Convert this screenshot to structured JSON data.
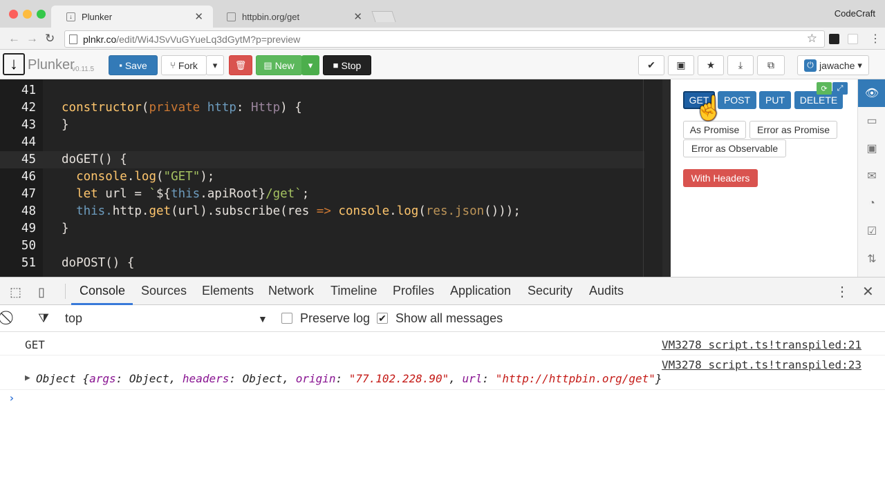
{
  "browser": {
    "tabs": [
      {
        "title": "Plunker",
        "active": true
      },
      {
        "title": "httpbin.org/get",
        "active": false
      }
    ],
    "profile": "CodeCraft",
    "url_host": "plnkr.co",
    "url_path": "/edit/Wi4JSvVuGYueLq3dGytM?p=preview"
  },
  "plunker": {
    "logo_text": "Plunker",
    "version": "v0.11.5",
    "buttons": {
      "save": "Save",
      "fork": "Fork",
      "new": "New",
      "stop": "Stop"
    },
    "user": "jawache"
  },
  "editor": {
    "lines": [
      {
        "n": "41",
        "tokens": []
      },
      {
        "n": "42",
        "tokens": [
          {
            "c": "fn",
            "t": "constructor"
          },
          {
            "c": "",
            "t": "("
          },
          {
            "c": "kw",
            "t": "private"
          },
          {
            "c": "",
            "t": " "
          },
          {
            "c": "ths",
            "t": "http"
          },
          {
            "c": "",
            "t": ": "
          },
          {
            "c": "tp",
            "t": "Http"
          },
          {
            "c": "",
            "t": ") {"
          }
        ]
      },
      {
        "n": "43",
        "tokens": [
          {
            "c": "",
            "t": "}"
          }
        ]
      },
      {
        "n": "44",
        "tokens": []
      },
      {
        "n": "45",
        "tokens": [
          {
            "c": "",
            "t": "doGET() {"
          }
        ]
      },
      {
        "n": "46",
        "tokens": [
          {
            "c": "",
            "t": "  "
          },
          {
            "c": "fn",
            "t": "console"
          },
          {
            "c": "",
            "t": "."
          },
          {
            "c": "fn",
            "t": "log"
          },
          {
            "c": "",
            "t": "("
          },
          {
            "c": "str",
            "t": "\"GET\""
          },
          {
            "c": "",
            "t": ");"
          }
        ]
      },
      {
        "n": "47",
        "tokens": [
          {
            "c": "",
            "t": "  "
          },
          {
            "c": "fn",
            "t": "let"
          },
          {
            "c": "",
            "t": " url = "
          },
          {
            "c": "str",
            "t": "`"
          },
          {
            "c": "",
            "t": "${"
          },
          {
            "c": "ths",
            "t": "this"
          },
          {
            "c": "",
            "t": ".apiRoot}"
          },
          {
            "c": "str",
            "t": "/get`"
          },
          {
            "c": "",
            "t": ";"
          }
        ]
      },
      {
        "n": "48",
        "tokens": [
          {
            "c": "",
            "t": "  "
          },
          {
            "c": "ths",
            "t": "this."
          },
          {
            "c": "",
            "t": "http."
          },
          {
            "c": "fn",
            "t": "get"
          },
          {
            "c": "",
            "t": "(url).subscribe(res "
          },
          {
            "c": "kw",
            "t": "=>"
          },
          {
            "c": "",
            "t": " "
          },
          {
            "c": "fn",
            "t": "console"
          },
          {
            "c": "",
            "t": "."
          },
          {
            "c": "fn",
            "t": "log"
          },
          {
            "c": "",
            "t": "("
          },
          {
            "c": "com",
            "t": "res.json"
          },
          {
            "c": "",
            "t": "()));"
          }
        ]
      },
      {
        "n": "49",
        "tokens": [
          {
            "c": "",
            "t": "}"
          }
        ]
      },
      {
        "n": "50",
        "tokens": []
      },
      {
        "n": "51",
        "tokens": [
          {
            "c": "",
            "t": "doPOST() {"
          }
        ]
      }
    ]
  },
  "preview": {
    "buttons": [
      "GET",
      "POST",
      "PUT",
      "DELETE"
    ],
    "outline_buttons": [
      "As Promise",
      "Error as Promise",
      "Error as Observable"
    ],
    "headers_button": "With Headers"
  },
  "devtools": {
    "tabs": [
      "Console",
      "Sources",
      "Elements",
      "Network",
      "Timeline",
      "Profiles",
      "Application",
      "Security",
      "Audits"
    ],
    "context": "top",
    "preserve_log": "Preserve log",
    "show_all": "Show all messages",
    "messages": [
      {
        "text": "GET",
        "source": "VM3278 script.ts!transpiled:21"
      },
      {
        "text": "",
        "source": "VM3278 script.ts!transpiled:23"
      }
    ],
    "object": {
      "prefix": "Object {",
      "k1": "args",
      "v1": "Object",
      "k2": "headers",
      "v2": "Object",
      "k3": "origin",
      "v3": "\"77.102.228.90\"",
      "k4": "url",
      "v4": "\"http://httpbin.org/get\"",
      "suffix": "}"
    },
    "prompt": "›"
  }
}
